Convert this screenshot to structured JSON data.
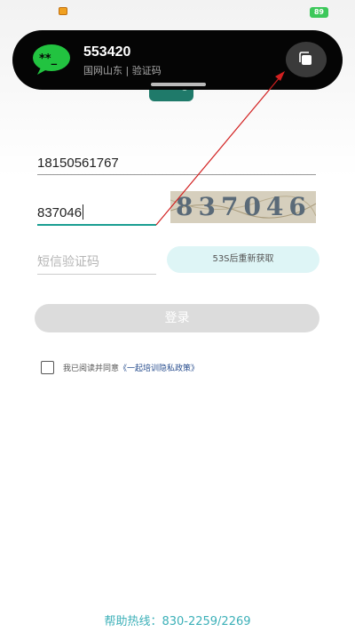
{
  "status_bar": {
    "battery": "89"
  },
  "notification": {
    "title": "553420",
    "subtitle": "国网山东 | 验证码",
    "icon_name": "message-icon",
    "copy_icon_name": "copy-icon"
  },
  "form": {
    "phone_value": "18150561767",
    "captcha_value": "837046",
    "captcha_image_text": "837046",
    "sms_placeholder": "短信验证码",
    "resend_label": "53S后重新获取",
    "login_label": "登录",
    "agree_prefix": "我已阅读并同意",
    "agree_link": "《一起培训隐私政策》"
  },
  "footer": {
    "hotline": "帮助热线：830-2259/2269"
  },
  "colors": {
    "accent": "#1a9e92",
    "hotline": "#3cb0b8",
    "notification_bg": "#050505",
    "arrow": "#d22020",
    "message_green": "#22c340"
  }
}
